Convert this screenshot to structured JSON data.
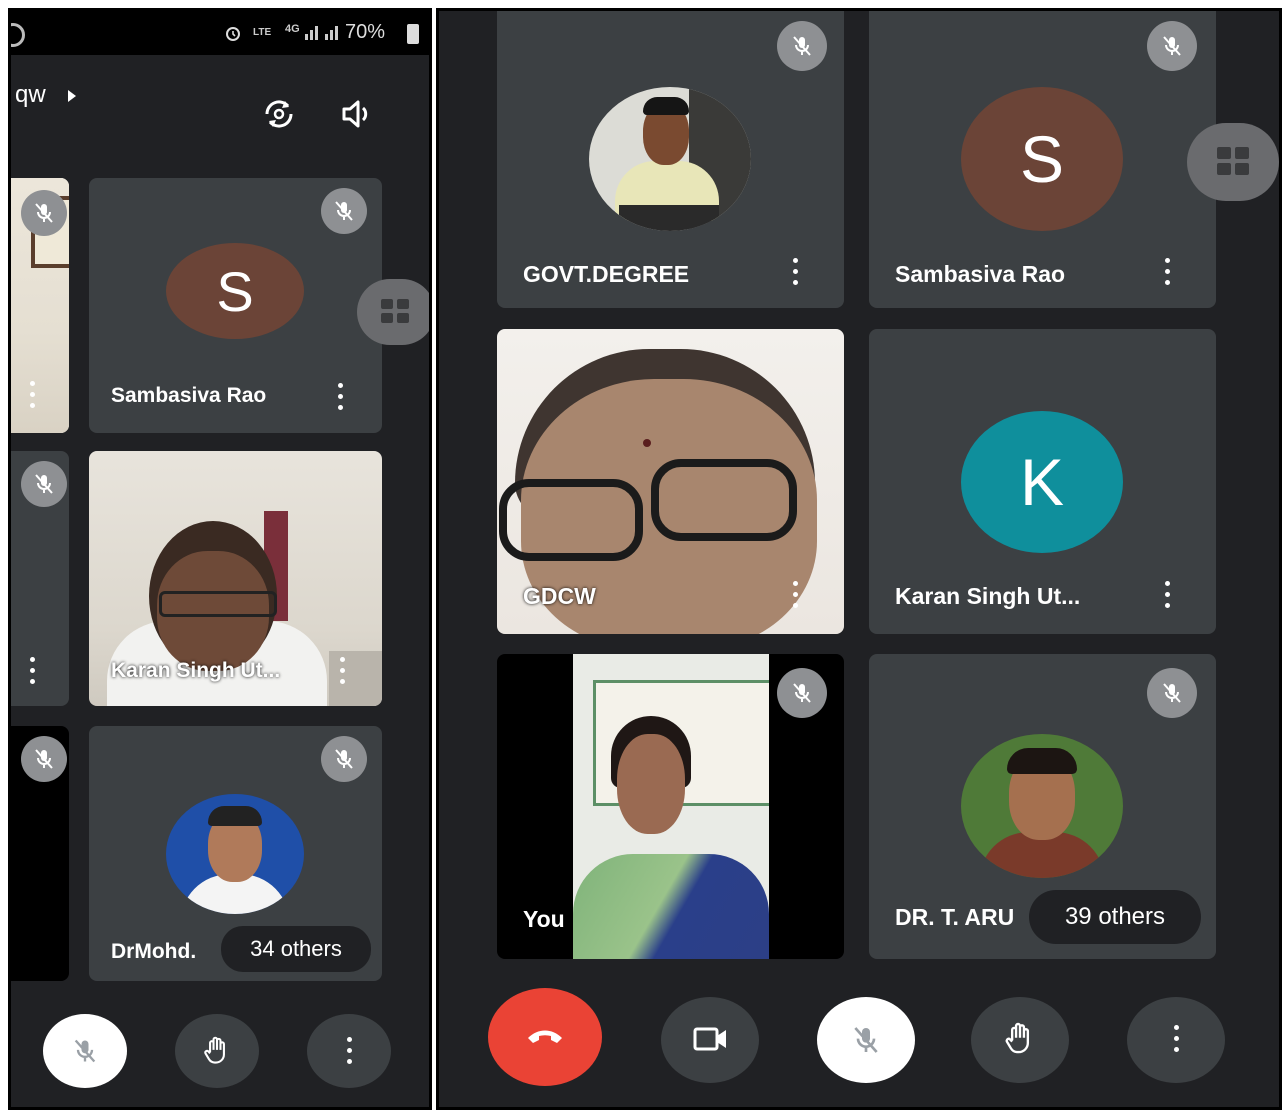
{
  "status_bar": {
    "battery": "70%",
    "network": "4G",
    "carrier": "LTE"
  },
  "left_panel": {
    "meeting_code": "qw",
    "tiles": [
      {
        "name": "Sambasiva Rao",
        "initial": "S"
      },
      {
        "name": "Karan Singh Ut..."
      },
      {
        "name": "DrMohd."
      }
    ],
    "others_count": "34 others"
  },
  "right_panel": {
    "tiles": [
      {
        "name": "GOVT.DEGREE"
      },
      {
        "name": "Sambasiva Rao",
        "initial": "S"
      },
      {
        "name": "GDCW"
      },
      {
        "name": "Karan Singh Ut...",
        "initial": "K"
      },
      {
        "name": "You"
      },
      {
        "name": "DR. T. ARU"
      }
    ],
    "others_count": "39 others"
  },
  "colors": {
    "background": "#202124",
    "tile": "#3c4043",
    "avatar_s": "#6b4437",
    "avatar_k": "#0f8f9c",
    "end_call": "#ea4335"
  }
}
